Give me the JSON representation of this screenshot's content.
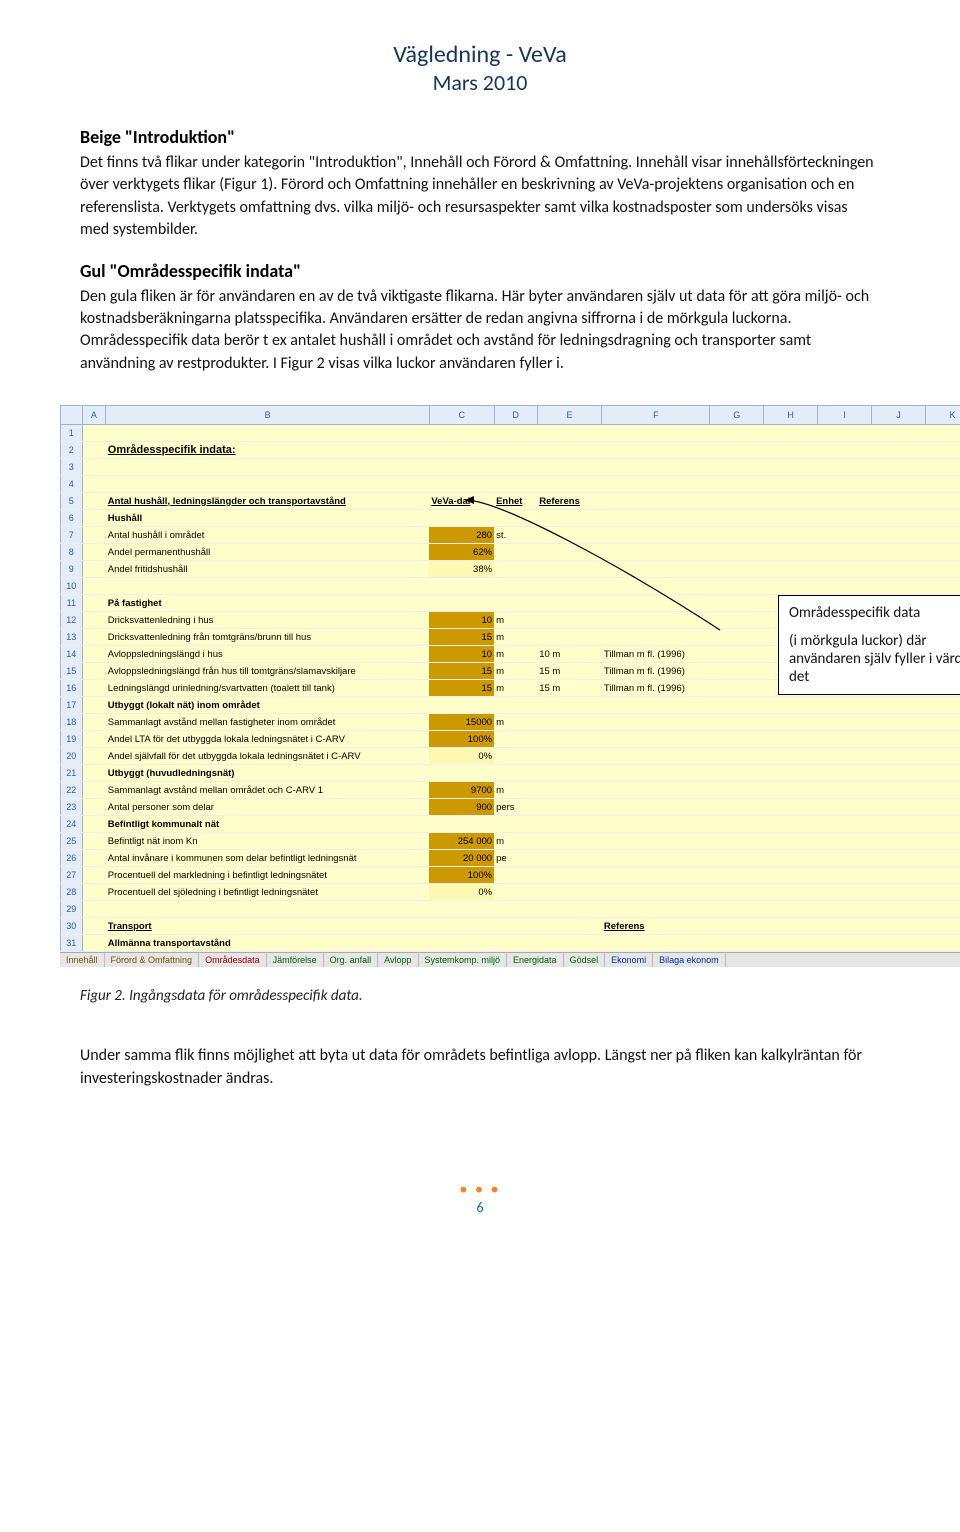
{
  "header": {
    "line1": "Vägledning - VeVa",
    "line2": "Mars 2010"
  },
  "section1": {
    "heading": "Beige \"Introduktion\"",
    "body": "Det finns två flikar under kategorin \"Introduktion\", Innehåll och Förord & Omfattning. Innehåll visar innehållsförteckningen över verktygets flikar (Figur 1). Förord och Omfattning innehåller en beskrivning av VeVa-projektens organisation och en referenslista. Verktygets omfattning dvs. vilka miljö- och resursaspekter samt vilka kostnadsposter som undersöks visas med systembilder."
  },
  "section2": {
    "heading": "Gul \"Områdesspecifik indata\"",
    "body": "Den gula fliken är för användaren en av de två viktigaste flikarna. Här byter användaren själv ut data för att göra miljö- och kostnadsberäkningarna platsspecifika. Användaren ersätter de redan angivna siffrorna i de mörkgula luckorna. Områdesspecifik data berör t ex antalet hushåll i området och avstånd för ledningsdragning och transporter samt användning av restprodukter. I Figur 2 visas vilka luckor användaren fyller i."
  },
  "ss": {
    "cols": [
      "",
      "A",
      "B",
      "C",
      "D",
      "E",
      "F",
      "G",
      "H",
      "I",
      "J",
      "K"
    ],
    "title": "Områdesspecifik indata:",
    "r5": {
      "label": "Antal hushåll, ledningslängder och transportavstånd",
      "col_c": "VeVa-dal",
      "col_d": "Enhet",
      "col_e": "Referens"
    },
    "r6": "Hushåll",
    "r7": {
      "label": "Antal hushåll i området",
      "val": "280",
      "u": "st."
    },
    "r8": {
      "label": "Andel permanenthushåll",
      "val": "62%"
    },
    "r9": {
      "label": "Andel fritidshushåll",
      "val": "38%"
    },
    "r11": "På fastighet",
    "r12": {
      "label": "Dricksvattenledning i hus",
      "val": "10",
      "u": "m"
    },
    "r13": {
      "label": "Dricksvattenledning från tomtgräns/brunn till hus",
      "val": "15",
      "u": "m"
    },
    "r14": {
      "label": "Avloppsledningslängd i hus",
      "val": "10",
      "u": "m",
      "d": "10 m",
      "ref": "Tillman m fl. (1996)"
    },
    "r15": {
      "label": "Avloppsledningslängd från hus till tomtgräns/slamavskiljare",
      "val": "15",
      "u": "m",
      "d": "15 m",
      "ref": "Tillman m fl. (1996)"
    },
    "r16": {
      "label": "Ledningslängd urinledning/svartvatten (toalett till tank)",
      "val": "15",
      "u": "m",
      "d": "15 m",
      "ref": "Tillman m fl. (1996)"
    },
    "r17": "Utbyggt (lokalt nät) inom området",
    "r18": {
      "label": "Sammanlagt avstånd mellan fastigheter inom området",
      "val": "15000",
      "u": "m"
    },
    "r19": {
      "label": "Andel LTA för det utbyggda lokala ledningsnätet i C-ARV",
      "val": "100%"
    },
    "r20": {
      "label": "Andel självfall för det utbyggda lokala ledningsnätet i C-ARV",
      "val": "0%"
    },
    "r21": "Utbyggt (huvudledningsnät)",
    "r22": {
      "label": "Sammanlagt avstånd mellan området och C-ARV 1",
      "val": "9700",
      "u": "m"
    },
    "r23": {
      "label": "Antal personer som delar",
      "val": "900",
      "u": "pers"
    },
    "r24": "Befintligt kommunalt nät",
    "r25": {
      "label": "Befintligt nät inom Kn",
      "val": "254 000",
      "u": "m"
    },
    "r26": {
      "label": "Antal invånare i kommunen som delar befintligt ledningsnät",
      "val": "20 000",
      "u": "pe"
    },
    "r27": {
      "label": "Procentuell del markledning i befintligt ledningsnätet",
      "val": "100%"
    },
    "r28": {
      "label": "Procentuell del sjöledning i befintligt ledningsnätet",
      "val": "0%"
    },
    "r30": "Transport",
    "r30ref": "Referens",
    "r31": "Allmänna transportavstånd",
    "tabs": [
      "Innehåll",
      "Förord & Omfattning",
      "Områdesdata",
      "Jämförelse",
      "Org. anfall",
      "Avlopp",
      "Systemkomp. miljö",
      "Energidata",
      "Gödsel",
      "Ekonomi",
      "Bilaga ekonom"
    ]
  },
  "annotation": {
    "title": "Områdesspecifik data",
    "body": "(i mörkgula luckor) där användaren själv fyller i värden för det"
  },
  "caption": "Figur 2. Ingångsdata för områdesspecifik data.",
  "lower": "Under samma flik finns möjlighet att byta ut data för områdets befintliga avlopp. Längst ner på fliken kan kalkylräntan för investeringskostnader ändras.",
  "pagenum": "6"
}
